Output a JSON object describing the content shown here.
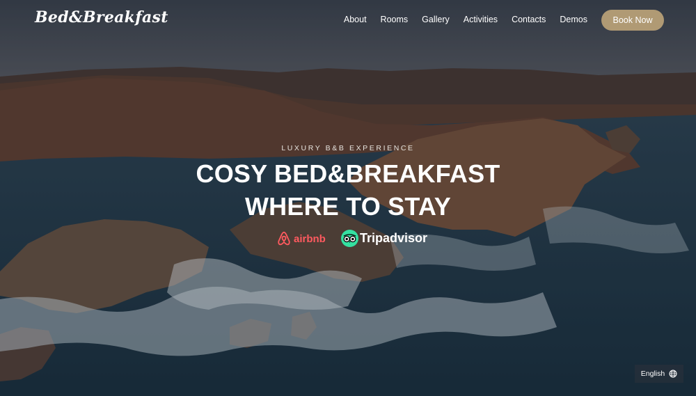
{
  "brand": {
    "logo_text": "Bed&Breakfast"
  },
  "nav": {
    "items": [
      {
        "label": "About"
      },
      {
        "label": "Rooms"
      },
      {
        "label": "Gallery"
      },
      {
        "label": "Activities"
      },
      {
        "label": "Contacts"
      },
      {
        "label": "Demos"
      }
    ],
    "cta_label": "Book Now"
  },
  "hero": {
    "tagline": "LUXURY B&B EXPERIENCE",
    "title_line1": "COSY BED&BREAKFAST",
    "title_line2": "WHERE TO STAY"
  },
  "partners": {
    "airbnb_label": "airbnb",
    "tripadvisor_label": "Tripadvisor",
    "icons": [
      "airbnb-icon",
      "tripadvisor-owl-icon"
    ]
  },
  "language": {
    "label": "English",
    "icon": "globe-icon"
  },
  "colors": {
    "accent": "#b09a74",
    "airbnb": "#ff5a5f",
    "tripadvisor": "#34e0a1",
    "text": "#ffffff"
  }
}
